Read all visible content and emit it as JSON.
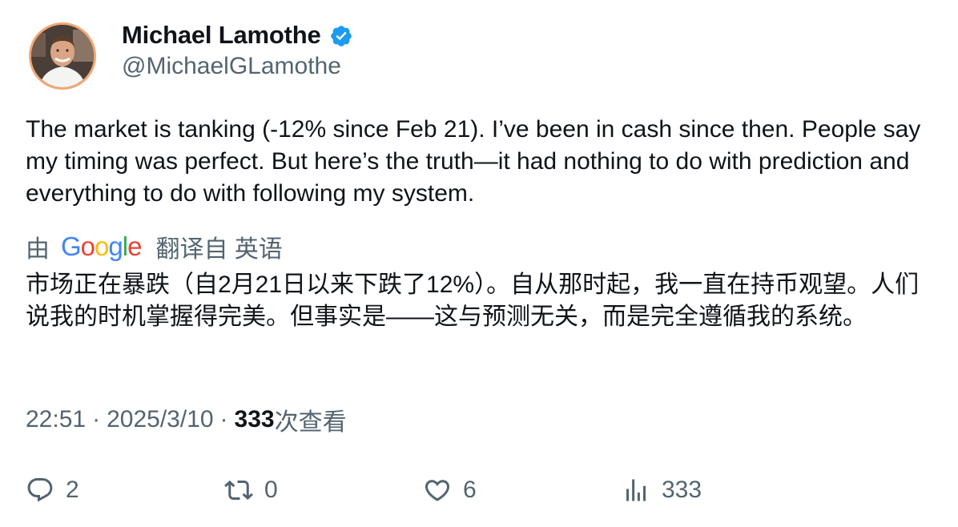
{
  "author": {
    "display_name": "Michael Lamothe",
    "handle": "@MichaelGLamothe",
    "verified": true,
    "verified_color": "#1d9bf0"
  },
  "tweet": {
    "text": "The market is tanking (-12% since Feb 21). I’ve been in cash since then. People say my timing was perfect. But here’s the truth—it had nothing to do with prediction and everything to do with following my system."
  },
  "translation": {
    "prefix": "由",
    "provider": "Google",
    "suffix": "翻译自 英语",
    "text": "市场正在暴跌（自2月21日以来下跌了12%）。自从那时起，我一直在持币观望。人们说我的时机掌握得完美。但事实是——这与预测无关，而是完全遵循我的系统。"
  },
  "meta": {
    "time": "22:51",
    "separator": "·",
    "date": "2025/3/10",
    "views_count": "333",
    "views_label": "次查看"
  },
  "actions": {
    "replies": "2",
    "retweets": "0",
    "likes": "6",
    "views": "333"
  },
  "colors": {
    "text_primary": "#0f1419",
    "text_secondary": "#536471",
    "avatar_ring": "#f0a875"
  },
  "icons": {
    "reply": "reply-icon",
    "retweet": "retweet-icon",
    "like": "heart-icon",
    "views": "analytics-icon",
    "verified": "verified-badge-icon"
  }
}
